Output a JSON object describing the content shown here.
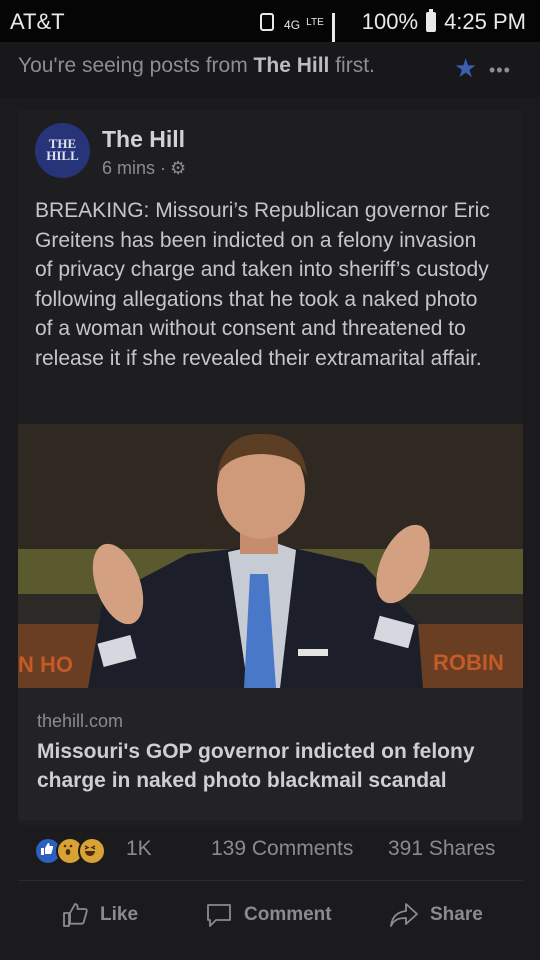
{
  "status_bar": {
    "carrier": "AT&T",
    "network": "4G",
    "lte": "LTE",
    "battery": "100%",
    "time": "4:25 PM"
  },
  "see_first": {
    "prefix": "You're seeing posts from ",
    "page": "The Hill",
    "suffix": " first.",
    "more": "•••"
  },
  "post": {
    "avatar_text_line1": "THE",
    "avatar_text_line2": "HILL",
    "page_name": "The Hill",
    "time": "6 mins ·",
    "body": "BREAKING: Missouri’s Republican governor Eric Greitens has been indicted on a felony invasion of privacy charge and taken into sheriff’s custody following allegations that he took a naked photo of a woman without consent and threatened to release it if she revealed their extramarital affair.",
    "photo_sign_left": "N HO",
    "photo_sign_right": "ROBIN",
    "link_domain": "thehill.com",
    "link_title": "Missouri's GOP governor indicted on felony charge in naked photo blackmail scandal"
  },
  "engagement": {
    "reactions": "1K",
    "comments": "139 Comments",
    "shares": "391 Shares"
  },
  "actions": {
    "like": "Like",
    "comment": "Comment",
    "share": "Share"
  },
  "colors": {
    "accent": "#3b5eb0",
    "background": "#1b1b1d"
  }
}
